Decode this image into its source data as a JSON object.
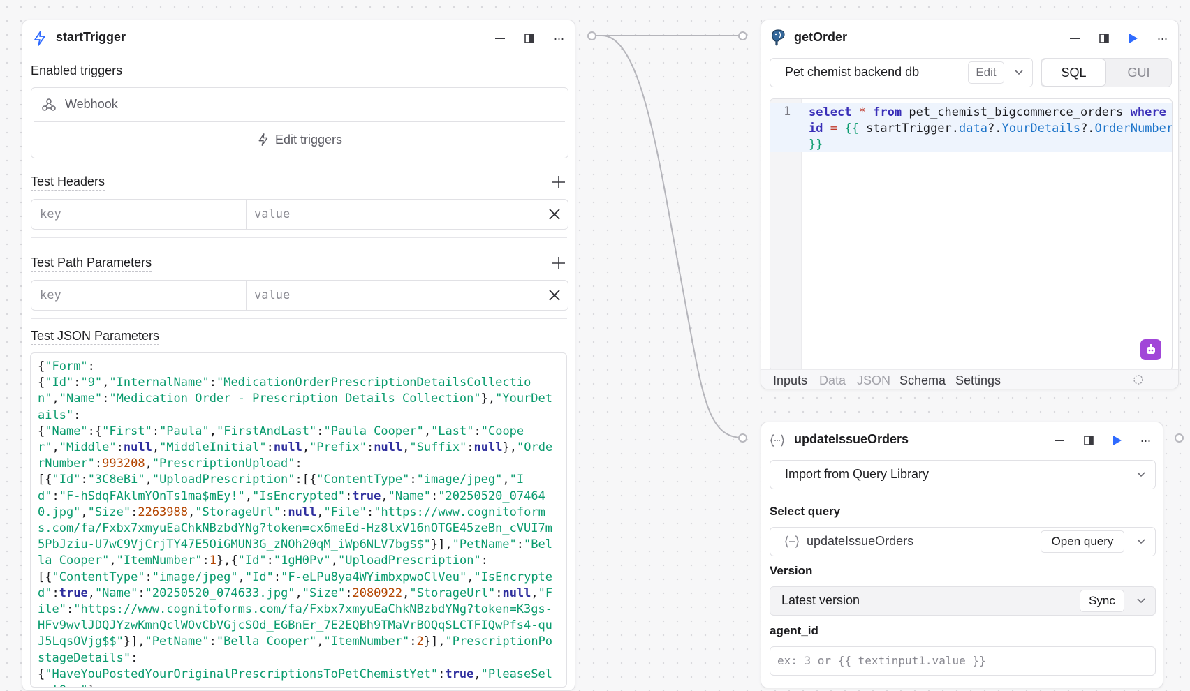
{
  "start": {
    "title": "startTrigger",
    "enabled_label": "Enabled triggers",
    "webhook_label": "Webhook",
    "edit_triggers": "Edit triggers",
    "headers_label": "Test Headers",
    "path_label": "Test Path Parameters",
    "json_label": "Test JSON Parameters",
    "key_placeholder": "key",
    "value_placeholder": "value"
  },
  "getOrder": {
    "title": "getOrder",
    "db": "Pet chemist backend db",
    "edit": "Edit",
    "sql": "SQL",
    "gui": "GUI",
    "line_number": "1",
    "tabs": [
      "Inputs",
      "Data",
      "JSON",
      "Schema",
      "Settings"
    ]
  },
  "update": {
    "title": "updateIssueOrders",
    "import_label": "Import from Query Library",
    "select_query_label": "Select query",
    "query_name": "updateIssueOrders",
    "open_query": "Open query",
    "version_label": "Version",
    "version_value": "Latest version",
    "sync": "Sync",
    "agent_label": "agent_id",
    "agent_placeholder": "ex: 3 or {{ textinput1.value }}"
  },
  "colors": {
    "accent": "#2f6bff",
    "json_string": "#0a9b6e",
    "json_number": "#b34500",
    "keyword": "#3a2fb8",
    "ai_button": "#a146d8"
  }
}
